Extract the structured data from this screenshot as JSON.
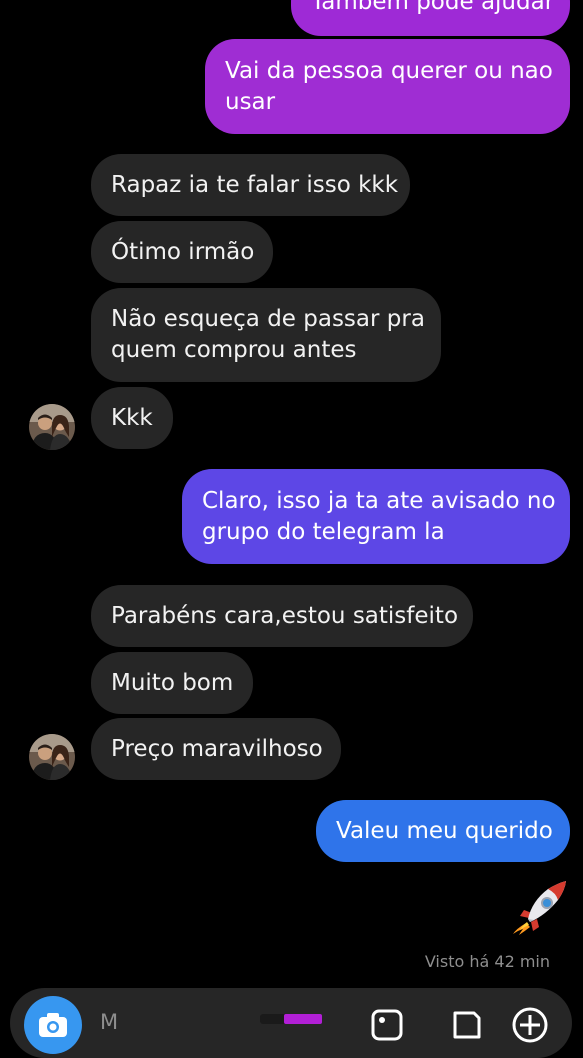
{
  "colors": {
    "background": "#000000",
    "incoming_bubble": "#262626",
    "outgoing_purple": "#9e2ad6",
    "outgoing_indigo": "#5d47e6",
    "outgoing_blue": "#2f74ea",
    "seen_text": "#8e8e8e",
    "camera_button": "#3797f0"
  },
  "messages": {
    "m0": {
      "from": "me",
      "text": "Também pode ajudar"
    },
    "m1": {
      "from": "me",
      "line1": "Vai da pessoa querer ou nao",
      "line2": "usar"
    },
    "m2": {
      "from": "them",
      "text": "Rapaz ia te falar isso kkk"
    },
    "m3": {
      "from": "them",
      "text": "Ótimo irmão"
    },
    "m4": {
      "from": "them",
      "line1": "Não esqueça de passar pra",
      "line2": "quem comprou antes"
    },
    "m5": {
      "from": "them",
      "text": "Kkk"
    },
    "m6": {
      "from": "me",
      "line1": "Claro, isso ja ta ate avisado no",
      "line2": "grupo do telegram la"
    },
    "m7": {
      "from": "them",
      "text": "Parabéns cara,estou satisfeito"
    },
    "m8": {
      "from": "them",
      "text": "Muito bom"
    },
    "m9": {
      "from": "them",
      "text": "Preço maravilhoso"
    },
    "m10": {
      "from": "me",
      "text": "Valeu meu querido"
    },
    "m11": {
      "from": "me",
      "emoji": "rocket"
    }
  },
  "status": {
    "seen": "Visto há 42 min"
  },
  "composer": {
    "placeholder": "M"
  },
  "icons": [
    "avatar",
    "rocket-icon",
    "camera-icon",
    "gallery-icon",
    "sticker-icon"
  ]
}
